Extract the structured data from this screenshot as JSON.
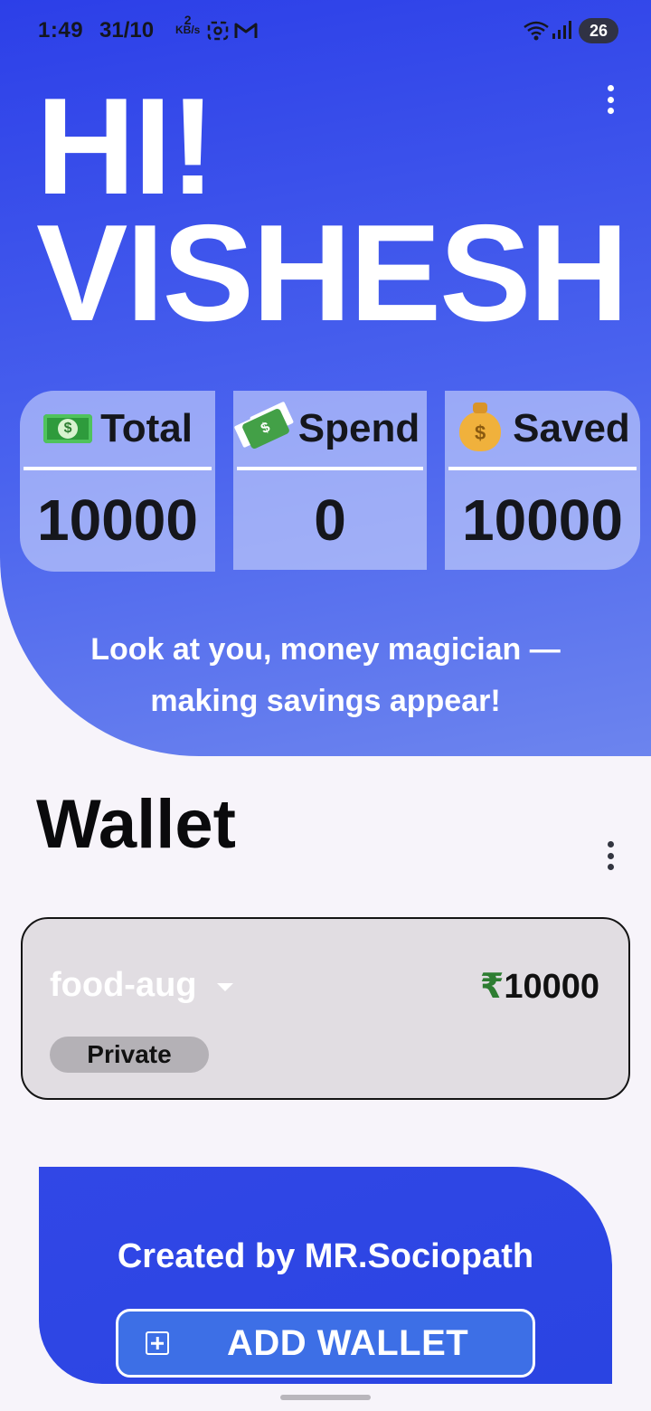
{
  "status_bar": {
    "time": "1:49",
    "date": "31/10",
    "speed_value": "2",
    "speed_unit": "KB/s",
    "battery": "26",
    "icons": [
      "screenshot-icon",
      "gmail-icon",
      "wifi-icon",
      "signal-icon",
      "battery-icon"
    ]
  },
  "header": {
    "greeting_line1": "HI!",
    "greeting_line2": "VISHESH",
    "menu_icon": "more-vert-icon"
  },
  "stats": [
    {
      "label": "Total",
      "value": "10000",
      "icon": "dollar-banknote-icon"
    },
    {
      "label": "Spend",
      "value": "0",
      "icon": "money-with-wings-icon"
    },
    {
      "label": "Saved",
      "value": "10000",
      "icon": "money-bag-icon"
    }
  ],
  "motto": "Look at you, money magician — making savings appear!",
  "wallet_section": {
    "title": "Wallet",
    "card": {
      "name": "food-aug",
      "currency_symbol": "₹",
      "amount": "10000",
      "visibility": "Private"
    }
  },
  "footer": {
    "credit": "Created by MR.Sociopath",
    "add_button_label": "ADD WALLET"
  },
  "colors": {
    "primary": "#2c3fe8",
    "accent_button": "#3d6fe6",
    "rupee_green": "#2e7d32",
    "card_bg": "#e1dde2"
  }
}
